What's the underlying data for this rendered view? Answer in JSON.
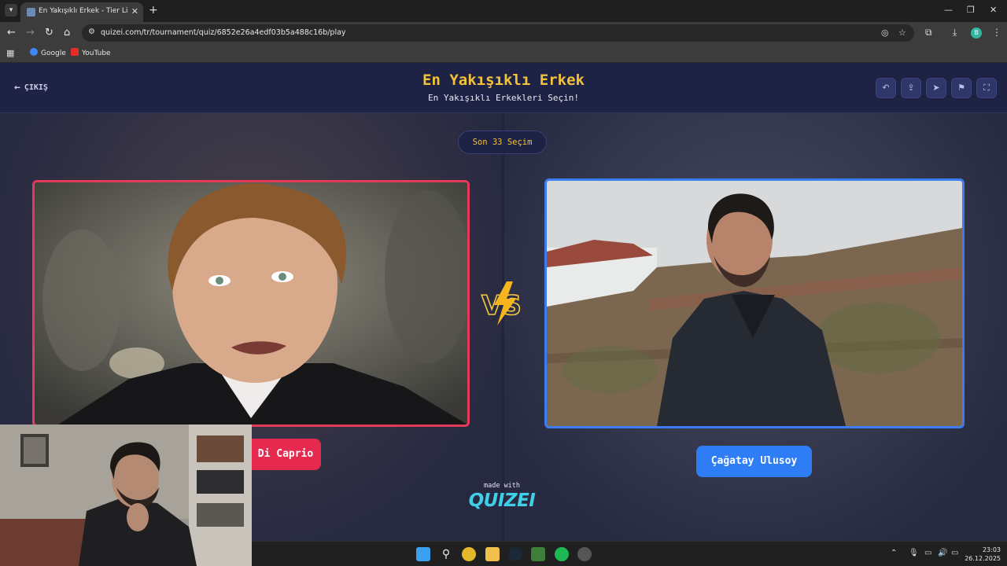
{
  "browser": {
    "tab_title": "En Yakışıklı Erkek - Tier List, Kor",
    "url": "quizei.com/tr/tournament/quiz/6852e26a4edf03b5a488c16b/play",
    "profile_initial": "B",
    "bookmarks": [
      {
        "label": "Google",
        "color": "#4285f4"
      },
      {
        "label": "YouTube",
        "color": "#ff0000"
      }
    ]
  },
  "header": {
    "exit_label": "ÇIKIŞ",
    "title": "En Yakışıklı Erkek",
    "subtitle": "En Yakışıklı Erkekleri Seçin!",
    "buttons": [
      "undo-icon",
      "share-icon",
      "send-icon",
      "flag-icon",
      "fullscreen-icon"
    ]
  },
  "round_label": "Son 33 Seçim",
  "left_choice": {
    "name": "Di Caprio",
    "accent": "#e5294f"
  },
  "right_choice": {
    "name": "Çağatay Ulusoy",
    "accent": "#2f7df4"
  },
  "vs_label": "VS",
  "footer": {
    "made_with": "made with",
    "brand": "QUIZEI"
  },
  "taskbar": {
    "time": "23:03",
    "date": "26.12.2025"
  },
  "colors": {
    "title": "#f3c13a",
    "header_bg": "#1e2244",
    "brand": "#3fd0e8"
  }
}
